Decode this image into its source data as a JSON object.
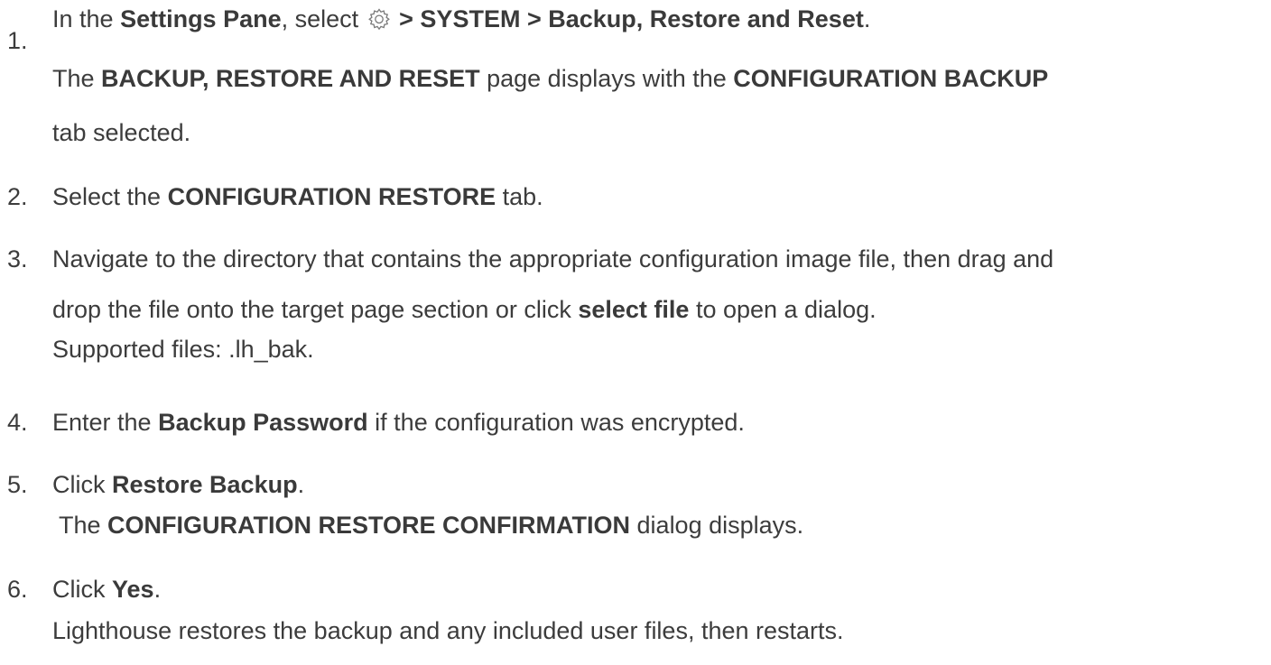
{
  "steps": [
    {
      "number": "1.",
      "line1": {
        "a": "In the ",
        "b1": "Settings Pane",
        "c": ", select ",
        "icon": "gear-icon",
        "b2": " > SYSTEM > Backup, Restore and Reset",
        "d": "."
      },
      "line2": {
        "a": "The ",
        "b1": "BACKUP, RESTORE AND RESET",
        "c": " page displays with the ",
        "b2": "CONFIGURATION BACKUP"
      },
      "line3": "tab selected."
    },
    {
      "number": "2.",
      "a": "Select the ",
      "b": "CONFIGURATION RESTORE",
      "c": " tab."
    },
    {
      "number": "3.",
      "line1": "Navigate to the directory that contains the appropriate configuration image file, then drag and",
      "line2": {
        "a": "drop the file onto the target page section or click ",
        "b": "select file",
        "c": " to open a dialog."
      },
      "line3": "Supported files: .lh_bak."
    },
    {
      "number": "4.",
      "a": "Enter the ",
      "b": "Backup Password",
      "c": " if the configuration was encrypted."
    },
    {
      "number": "5.",
      "line1": {
        "a": "Click ",
        "b": "Restore Backup",
        "c": "."
      },
      "line2": {
        "a": " The ",
        "b": "CONFIGURATION RESTORE CONFIRMATION",
        "c": " dialog displays."
      }
    },
    {
      "number": "6.",
      "line1": {
        "a": "Click ",
        "b": "Yes",
        "c": "."
      },
      "line2": "Lighthouse restores the backup and any included user files, then restarts."
    }
  ]
}
